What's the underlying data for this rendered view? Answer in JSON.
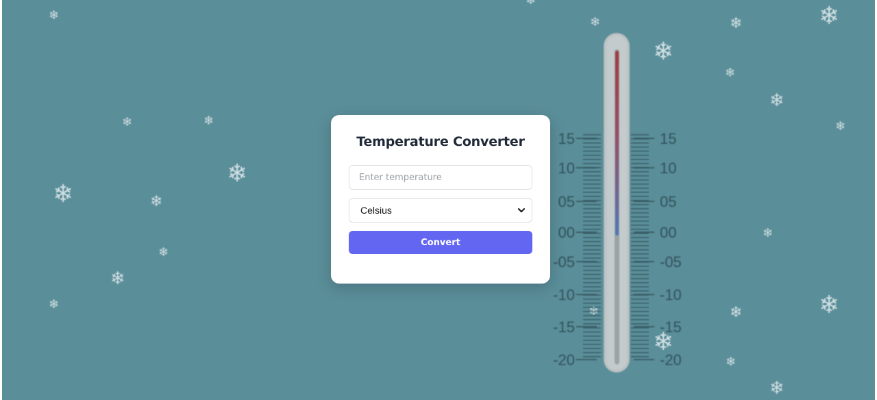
{
  "converter": {
    "title": "Temperature Converter",
    "input_placeholder": "Enter temperature",
    "input_value": "",
    "unit_selected": "Celsius",
    "convert_label": "Convert"
  },
  "thermometer": {
    "left_scale": [
      "15",
      "10",
      "05",
      "00",
      "-05",
      "-10",
      "-15",
      "-20"
    ],
    "right_scale": [
      "15",
      "10",
      "05",
      "00",
      "-05",
      "-10",
      "-15",
      "-20"
    ]
  },
  "colors": {
    "background": "#5a8e99",
    "accent": "#6366f1",
    "card": "#ffffff"
  },
  "icons": {
    "snowflake": "snowflake-icon",
    "dropdown": "chevron-down-icon"
  }
}
